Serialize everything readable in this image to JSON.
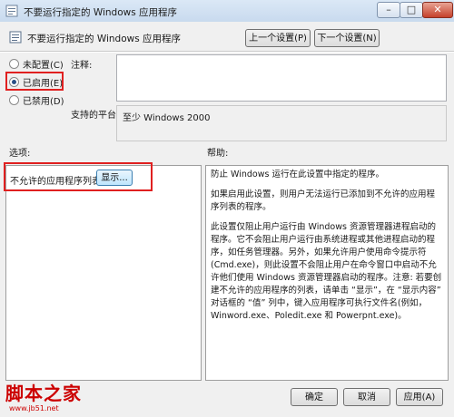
{
  "window": {
    "title": "不要运行指定的 Windows 应用程序",
    "min_glyph": "–",
    "max_glyph": "□",
    "close_glyph": "✕"
  },
  "header": {
    "title": "不要运行指定的 Windows 应用程序",
    "prev_label": "上一个设置(P)",
    "next_label": "下一个设置(N)"
  },
  "state": {
    "options": [
      {
        "label": "未配置(C)",
        "checked": false
      },
      {
        "label": "已启用(E)",
        "checked": true
      },
      {
        "label": "已禁用(D)",
        "checked": false
      }
    ]
  },
  "comment": {
    "label": "注释:",
    "value": ""
  },
  "platform": {
    "label": "支持的平台:",
    "value": "至少 Windows 2000"
  },
  "sections": {
    "options_label": "选项:",
    "help_label": "帮助:"
  },
  "options_pane": {
    "list_label": "不允许的应用程序列表",
    "show_button": "显示..."
  },
  "help": {
    "paragraphs": [
      "防止 Windows 运行在此设置中指定的程序。",
      "如果启用此设置，则用户无法运行已添加到不允许的应用程序列表的程序。",
      "此设置仅阻止用户运行由 Windows 资源管理器进程启动的程序。它不会阻止用户运行由系统进程或其他进程启动的程序，如任务管理器。另外，如果允许用户使用命令提示符(Cmd.exe)，则此设置不会阻止用户在命令窗口中启动不允许他们使用 Windows 资源管理器启动的程序。注意: 若要创建不允许的应用程序的列表，请单击 “显示”，在 “显示内容” 对话框的 “值” 列中，键入应用程序可执行文件名(例如，Winword.exe、Poledit.exe 和 Powerpnt.exe)。"
    ]
  },
  "footer": {
    "ok_label": "确定",
    "cancel_label": "取消",
    "apply_label": "应用(A)"
  },
  "watermark": {
    "text": "脚本之家",
    "url": "www.jb51.net"
  },
  "colors": {
    "highlight_box": "#e02020",
    "window_bg": "#f0f0f0"
  }
}
